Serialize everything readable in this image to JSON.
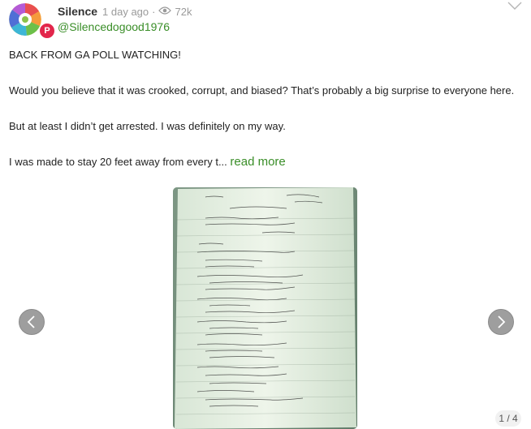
{
  "post": {
    "author": "Silence",
    "time_ago": "1 day ago",
    "separator": "·",
    "views": "72k",
    "handle": "@Silencedogood1976",
    "badge_letter": "P",
    "paragraphs": [
      "BACK FROM GA POLL WATCHING!",
      "Would you believe that it was crooked, corrupt, and biased? That’s probably a big surprise to everyone here.",
      "But at least I didn’t get arrested. I was definitely on my way.",
      "I was made to stay 20 feet away from every t..."
    ],
    "read_more": "read more"
  },
  "carousel": {
    "counter": "1 / 4"
  },
  "colors": {
    "handle": "#3a8e28",
    "read_more": "#3a8e28",
    "badge": "#e2264b"
  },
  "icons": [
    "avatar",
    "parler-badge",
    "eye-icon",
    "chevron-down-icon",
    "chevron-left-icon",
    "chevron-right-icon"
  ]
}
